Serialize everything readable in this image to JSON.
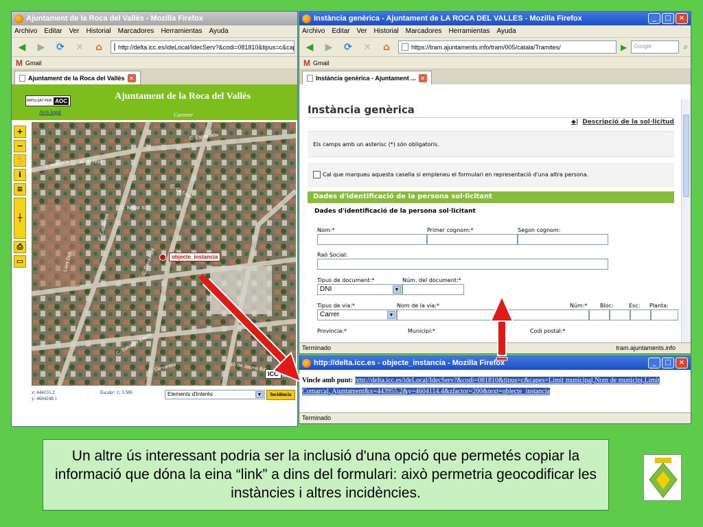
{
  "left_window": {
    "title": "Ajuntament de la Roca del Vallès - Mozilla Firefox",
    "menu": [
      "Archivo",
      "Editar",
      "Ver",
      "Historial",
      "Marcadores",
      "Herramientas",
      "Ayuda"
    ],
    "url": "http://delta.icc.es/ideLocal/IdecServ?&codi=081810&tipus=c&cap",
    "bookmark": "Gmail",
    "tab": "Ajuntament de la Roca del Vallès",
    "site_title": "Ajuntament de la Roca del Vallès",
    "logo_text": "IMPULSAT PER",
    "logo_mark": "AOC",
    "avis_legal": "Avís legal",
    "layer_label": "Carrerer",
    "map_label": "objecte_instancia",
    "coord_x": "x: 444155.2",
    "coord_y": "y: 4604248.1",
    "scale": "Escala= 1: 3.506",
    "elements_select": "Elements d'Interès",
    "incidencia_button": "Incidència",
    "streets": [
      "c. Indústria",
      "C. Esplanada",
      "pl. de l'Era",
      "C. Nebot XIX",
      "C. Casa Font",
      "C. Catalunya",
      "Llars Dolt",
      "C. Ca l'Ase",
      "C. Salvador Espriu",
      "C. Cervantes",
      "pl. de Jaume Balmes"
    ]
  },
  "right_window": {
    "title": "Instància genèrica - Ajuntament de LA ROCA DEL VALLES - Mozilla Firefox",
    "menu": [
      "Archivo",
      "Editar",
      "Ver",
      "Historial",
      "Marcadores",
      "Herramientas",
      "Ayuda"
    ],
    "url": "https://tram.ajuntaments.info/tram/005/catala/Tramites/",
    "search_placeholder": "Google",
    "bookmark": "Gmail",
    "tab": "Instància genèrica - Ajuntament ...",
    "heading": "Instància genèrica",
    "descripcio_link": "Descripció de la sol·licitud",
    "required_note": "Els camps amb un asterisc (*) són obligatoris.",
    "checkbox_label": "Cal que marqueu aquesta casella si empleneu el formulari en representació d'una altra persona.",
    "section_bar": "Dades d'identificació de la persona sol·licitant",
    "section_sub": "Dades d'identificació de la persona sol·licitant",
    "fields": {
      "nom": "Nom:*",
      "primer_cognom": "Primer cognom:*",
      "segon_cognom": "Segon cognom:",
      "rao_social": "Raó Social:",
      "tipus_document": "Tipus de document:*",
      "tipus_document_value": "DNI",
      "num_document": "Núm. del document:*",
      "tipus_via": "Tipus de via:*",
      "tipus_via_value": "Carrer",
      "nom_via": "Nom de la via:*",
      "num": "Núm:*",
      "bloc": "Bloc:",
      "esc": "Esc:",
      "planta": "Planta:",
      "provincia": "Província:*",
      "municipi": "Municipi:*",
      "codi_postal": "Codi postal:*"
    },
    "status_left": "Terminado",
    "status_right": "tram.ajuntaments.info"
  },
  "popup_window": {
    "title": "http://delta.icc.es - objecte_instancia - Mozilla Firefox",
    "label": "Vincle amb punt:",
    "link_text": "http://delta.icc.es/ideLocal/IdecServ?&codi=081810&tipus=c&capes=Limit municipal,Nom de municipi,Limit Comarcal, Ajuntament&x=443955.2&y=4604114.4&zfactor=200&text=objecte_instancia",
    "status": "Terminado"
  },
  "caption": "Un altre ús interessant podria ser la inclusió d'una opció que permetés copiar la informació que dóna la eina “link” a dins del formulari: això permetria geocodificar les instàncies i altres incidències.",
  "colors": {
    "page_bg": "#5fcb4a",
    "site_green": "#7dbd1e",
    "form_green": "#85bd3a",
    "arrow_red": "#e01a14"
  }
}
